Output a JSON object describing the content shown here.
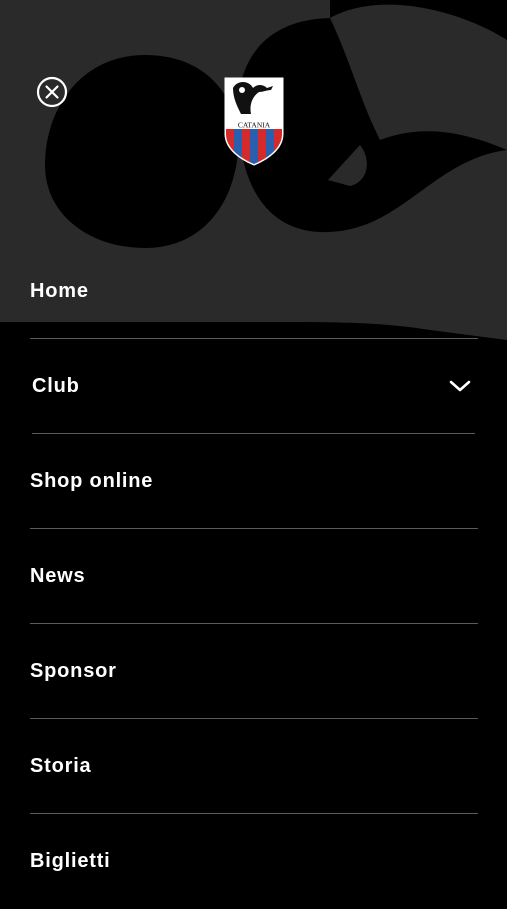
{
  "header": {
    "close_icon": "close-circle-icon",
    "logo": {
      "name": "catania-crest",
      "text": "CATANIA"
    }
  },
  "menu": {
    "items": [
      {
        "label": "Home",
        "has_submenu": false
      },
      {
        "label": "Club",
        "has_submenu": true,
        "icon": "chevron-down-icon"
      },
      {
        "label": "Shop online",
        "has_submenu": false
      },
      {
        "label": "News",
        "has_submenu": false
      },
      {
        "label": "Sponsor",
        "has_submenu": false
      },
      {
        "label": "Storia",
        "has_submenu": false
      },
      {
        "label": "Biglietti",
        "has_submenu": false
      }
    ]
  },
  "colors": {
    "background": "#000000",
    "graphic": "#2a2a2a",
    "divider": "#5a5a5a",
    "text": "#ffffff",
    "crest_red": "#d42a2a",
    "crest_blue": "#2a5fb0"
  }
}
